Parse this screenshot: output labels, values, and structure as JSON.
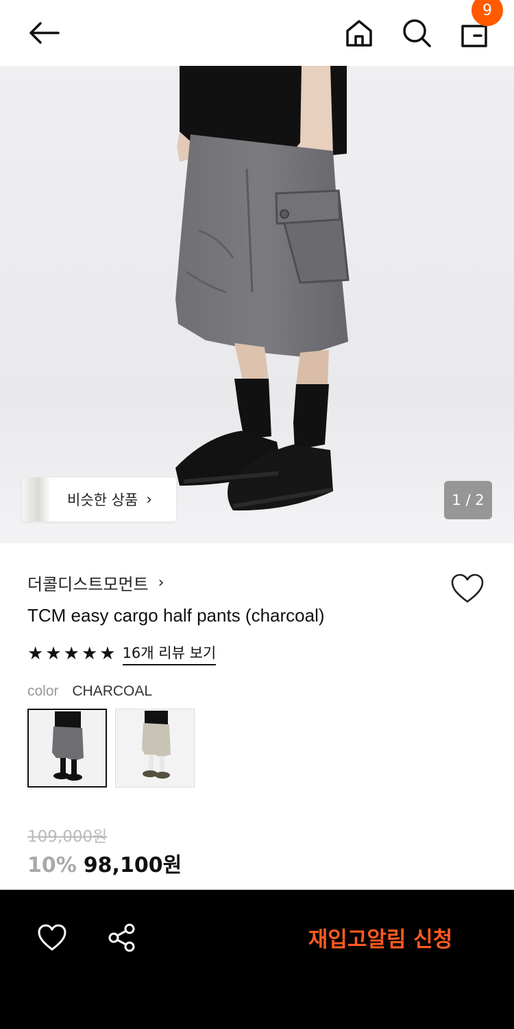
{
  "header": {
    "back_icon": "arrow-left-icon",
    "home_icon": "home-icon",
    "search_icon": "search-icon",
    "cart_icon": "shopping-bag-icon",
    "cart_count": "9",
    "badge_color": "#ff5a00"
  },
  "gallery": {
    "similar_label": "비슷한 상품",
    "similar_chevron": "›",
    "counter": "1 / 2"
  },
  "product": {
    "brand": "더콜디스트모먼트",
    "brand_chevron": "›",
    "title": "TCM easy cargo half pants (charcoal)",
    "rating_stars": 5,
    "review_link": "16개 리뷰 보기",
    "option_label": "color",
    "option_value": "CHARCOAL",
    "swatches": [
      "charcoal",
      "beige"
    ],
    "original_price": "109,000원",
    "discount": "10%",
    "sale_price": "98,100원"
  },
  "bottom_bar": {
    "like_icon": "heart-outline-icon",
    "share_icon": "share-icon",
    "restock_label": "재입고알림 신청",
    "restock_color": "#ff5a1f"
  }
}
